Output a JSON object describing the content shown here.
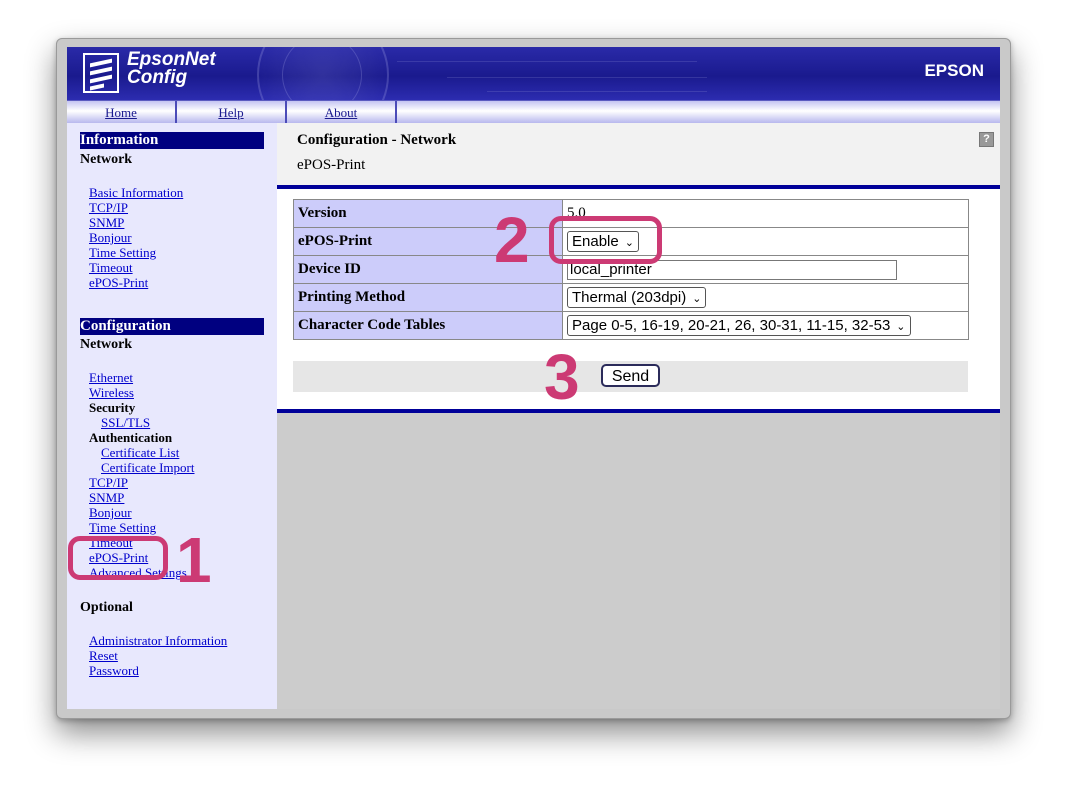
{
  "app": {
    "logo_line1": "EpsonNet",
    "logo_line2": "Config",
    "brand": "EPSON"
  },
  "nav": {
    "home": "Home",
    "help": "Help",
    "about": "About"
  },
  "sidebar": {
    "information": {
      "header": "Information",
      "subheader": "Network",
      "links": [
        "Basic Information",
        "TCP/IP",
        "SNMP",
        "Bonjour",
        "Time Setting",
        "Timeout",
        "ePOS-Print"
      ]
    },
    "configuration": {
      "header": "Configuration",
      "subheader": "Network",
      "ethernet": "Ethernet",
      "wireless": "Wireless",
      "security": "Security",
      "ssl_tls": "SSL/TLS",
      "authentication": "Authentication",
      "certificate_list": "Certificate List",
      "certificate_import": "Certificate Import",
      "tcpip": "TCP/IP",
      "snmp": "SNMP",
      "bonjour": "Bonjour",
      "time_setting": "Time Setting",
      "timeout": "Timeout",
      "epos_print": "ePOS-Print",
      "advanced": "Advanced Settings"
    },
    "optional": {
      "header": "Optional",
      "links": [
        "Administrator Information",
        "Reset",
        "Password"
      ]
    }
  },
  "main": {
    "title": "Configuration - Network",
    "subtitle": "ePOS-Print",
    "help_icon": "?",
    "rows": {
      "version": {
        "label": "Version",
        "value": "5.0"
      },
      "epos": {
        "label": "ePOS-Print",
        "value": "Enable"
      },
      "device": {
        "label": "Device ID",
        "value": "local_printer"
      },
      "method": {
        "label": "Printing Method",
        "value": "Thermal (203dpi)"
      },
      "codes": {
        "label": "Character Code Tables",
        "value": "Page 0-5, 16-19, 20-21, 26, 30-31, 11-15, 32-53"
      }
    },
    "send_label": "Send"
  },
  "annotations": [
    "1",
    "2",
    "3"
  ],
  "colors": {
    "banner": "#1a1a8e",
    "sidebar_header": "#000080",
    "table_label_bg": "#ccccfa",
    "annotation": "#cc3a74",
    "link": "#0000cc"
  }
}
